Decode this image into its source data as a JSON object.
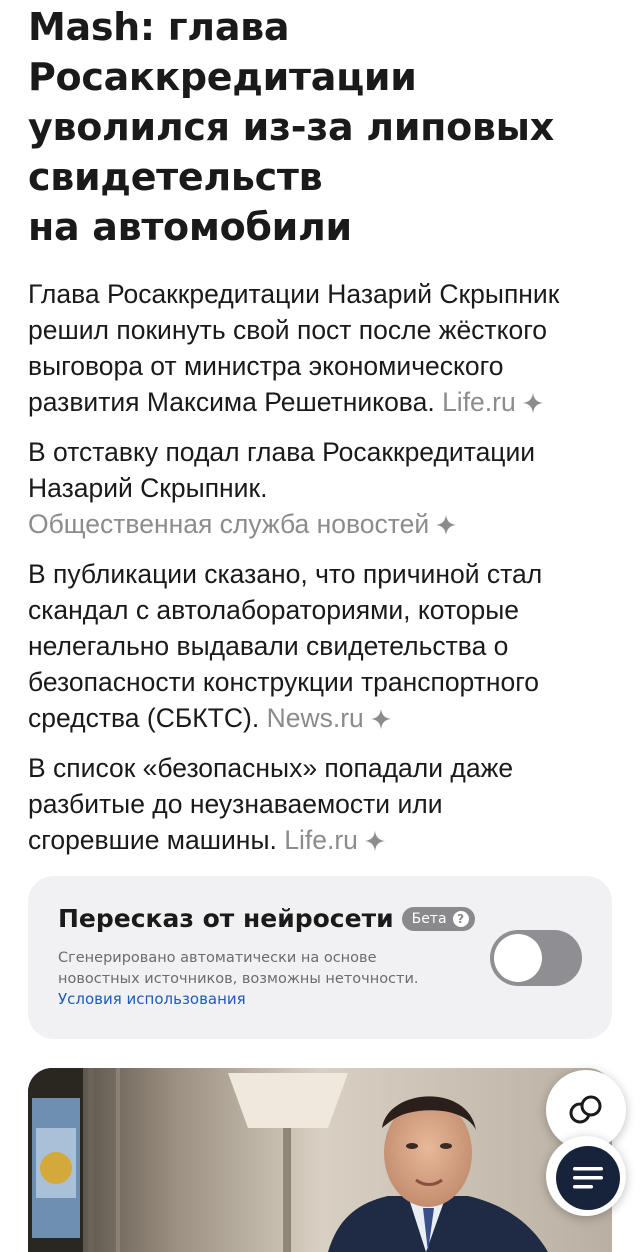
{
  "article": {
    "headline_lines": [
      "Mash: глава",
      "Росаккредитации",
      "уволился из-за липовых",
      "свидетельств",
      "на автомобили"
    ]
  },
  "summary": {
    "paragraphs": [
      {
        "lines": [
          "Глава Росаккредитации Назарий Скрыпник",
          "решил покинуть свой пост после жёсткого",
          "выговора от министра экономического",
          "развития Максима Решетникова."
        ],
        "source": "Life.ru"
      },
      {
        "lines": [
          "В отставку подал глава Росаккредитации",
          "Назарий Скрыпник."
        ],
        "source": "Общественная служба новостей"
      },
      {
        "lines": [
          "В публикации сказано, что причиной стал",
          "скандал с автолабораториями, которые",
          "нелегально выдавали свидетельства о",
          "безопасности конструкции транспортного",
          "средства (СБКТС)."
        ],
        "source": "News.ru"
      },
      {
        "lines": [
          "В список «безопасных» попадали даже",
          "разбитые до неузнаваемости или",
          "сгоревшие машины."
        ],
        "source": "Life.ru"
      }
    ]
  },
  "ai_retelling": {
    "title": "Пересказ от нейросети",
    "badge": "Бета",
    "badge_help": "?",
    "note_lines": [
      "Сгенерировано автоматически на основе",
      "новостных источников, возможны неточности."
    ],
    "terms_link": "Условия использования",
    "toggle_on": false
  },
  "icons": {
    "source_spark": "sparkle-icon",
    "sources_button": "overlapping-circles-icon",
    "menu_button": "hamburger-menu-icon"
  },
  "colors": {
    "text": "#1a1a1a",
    "source": "#8c8c8c",
    "card_bg": "#f1f1f3",
    "link": "#1d5bbf",
    "toggle_off": "#8e8e93",
    "menu_button": "#16233a"
  }
}
